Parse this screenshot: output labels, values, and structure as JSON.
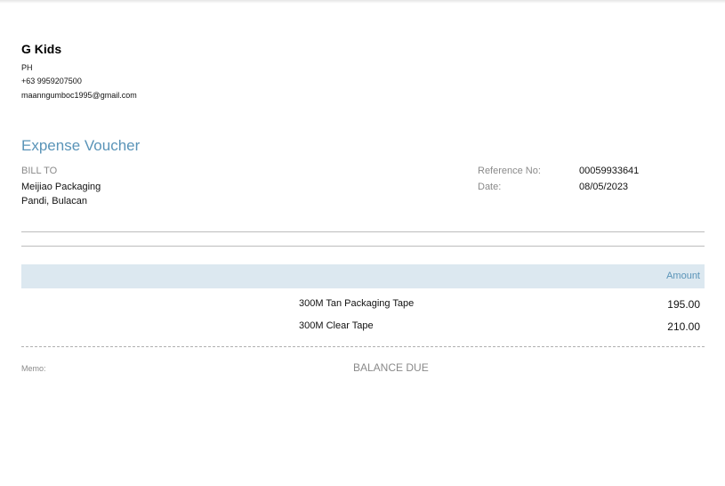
{
  "company": {
    "name": "G Kids",
    "country": "PH",
    "phone": "+63 9959207500",
    "email": "maanngumboc1995@gmail.com"
  },
  "document": {
    "title": "Expense Voucher"
  },
  "bill_to": {
    "label": "BILL TO",
    "name": "Meijiao Packaging",
    "address": "Pandi, Bulacan"
  },
  "meta": {
    "reference_label": "Reference No:",
    "reference_value": "00059933641",
    "date_label": "Date:",
    "date_value": "08/05/2023"
  },
  "table": {
    "amount_header": "Amount",
    "items": [
      {
        "description": "300M Tan Packaging Tape",
        "amount": "195.00"
      },
      {
        "description": "300M Clear Tape",
        "amount": "210.00"
      }
    ]
  },
  "footer": {
    "memo_label": "Memo:",
    "balance_due_label": "BALANCE DUE"
  },
  "colors": {
    "accent": "#5a94b8",
    "header_band": "#dce8f0",
    "muted_text": "#8a8a8a"
  }
}
